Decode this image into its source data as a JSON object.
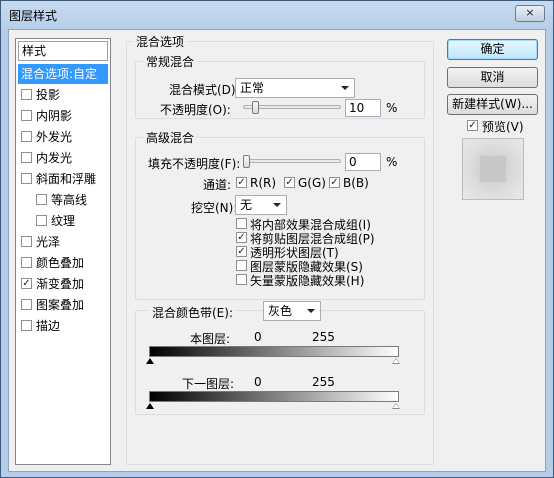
{
  "window": {
    "title": "图层样式",
    "close_label": "×"
  },
  "styles": {
    "header": "样式",
    "items": [
      {
        "label": "混合选项:自定",
        "selected": true
      },
      {
        "label": "投影",
        "checked": false
      },
      {
        "label": "内阴影",
        "checked": false
      },
      {
        "label": "外发光",
        "checked": false
      },
      {
        "label": "内发光",
        "checked": false
      },
      {
        "label": "斜面和浮雕",
        "checked": false
      },
      {
        "label": "等高线",
        "checked": false
      },
      {
        "label": "纹理",
        "checked": false
      },
      {
        "label": "光泽",
        "checked": false
      },
      {
        "label": "颜色叠加",
        "checked": false
      },
      {
        "label": "渐变叠加",
        "checked": true
      },
      {
        "label": "图案叠加",
        "checked": false
      },
      {
        "label": "描边",
        "checked": false
      }
    ]
  },
  "blend_options": {
    "title": "混合选项",
    "general": {
      "title": "常规混合",
      "mode_label": "混合模式(D):",
      "mode_value": "正常",
      "opacity_label": "不透明度(O):",
      "opacity_value": "10",
      "opacity_unit": "%",
      "opacity_fraction": 0.1
    },
    "advanced": {
      "title": "高级混合",
      "fill_label": "填充不透明度(F):",
      "fill_value": "0",
      "fill_unit": "%",
      "fill_fraction": 0.0,
      "channels_label": "通道:",
      "channels": [
        {
          "label": "R(R)",
          "checked": true
        },
        {
          "label": "G(G)",
          "checked": true
        },
        {
          "label": "B(B)",
          "checked": true
        }
      ],
      "knockout_label": "挖空(N):",
      "knockout_value": "无",
      "options": [
        {
          "label": "将内部效果混合成组(I)",
          "checked": false
        },
        {
          "label": "将剪贴图层混合成组(P)",
          "checked": true
        },
        {
          "label": "透明形状图层(T)",
          "checked": true
        },
        {
          "label": "图层蒙版隐藏效果(S)",
          "checked": false
        },
        {
          "label": "矢量蒙版隐藏效果(H)",
          "checked": false
        }
      ]
    },
    "blend_if": {
      "label": "混合颜色带(E):",
      "value": "灰色",
      "this_layer_label": "本图层:",
      "this_layer_min": "0",
      "this_layer_max": "255",
      "underlying_label": "下一图层:",
      "underlying_min": "0",
      "underlying_max": "255"
    }
  },
  "buttons": {
    "ok": "确定",
    "cancel": "取消",
    "new_style": "新建样式(W)...",
    "preview_label": "预览(V)",
    "preview_checked": true
  },
  "check_glyph": "✓"
}
